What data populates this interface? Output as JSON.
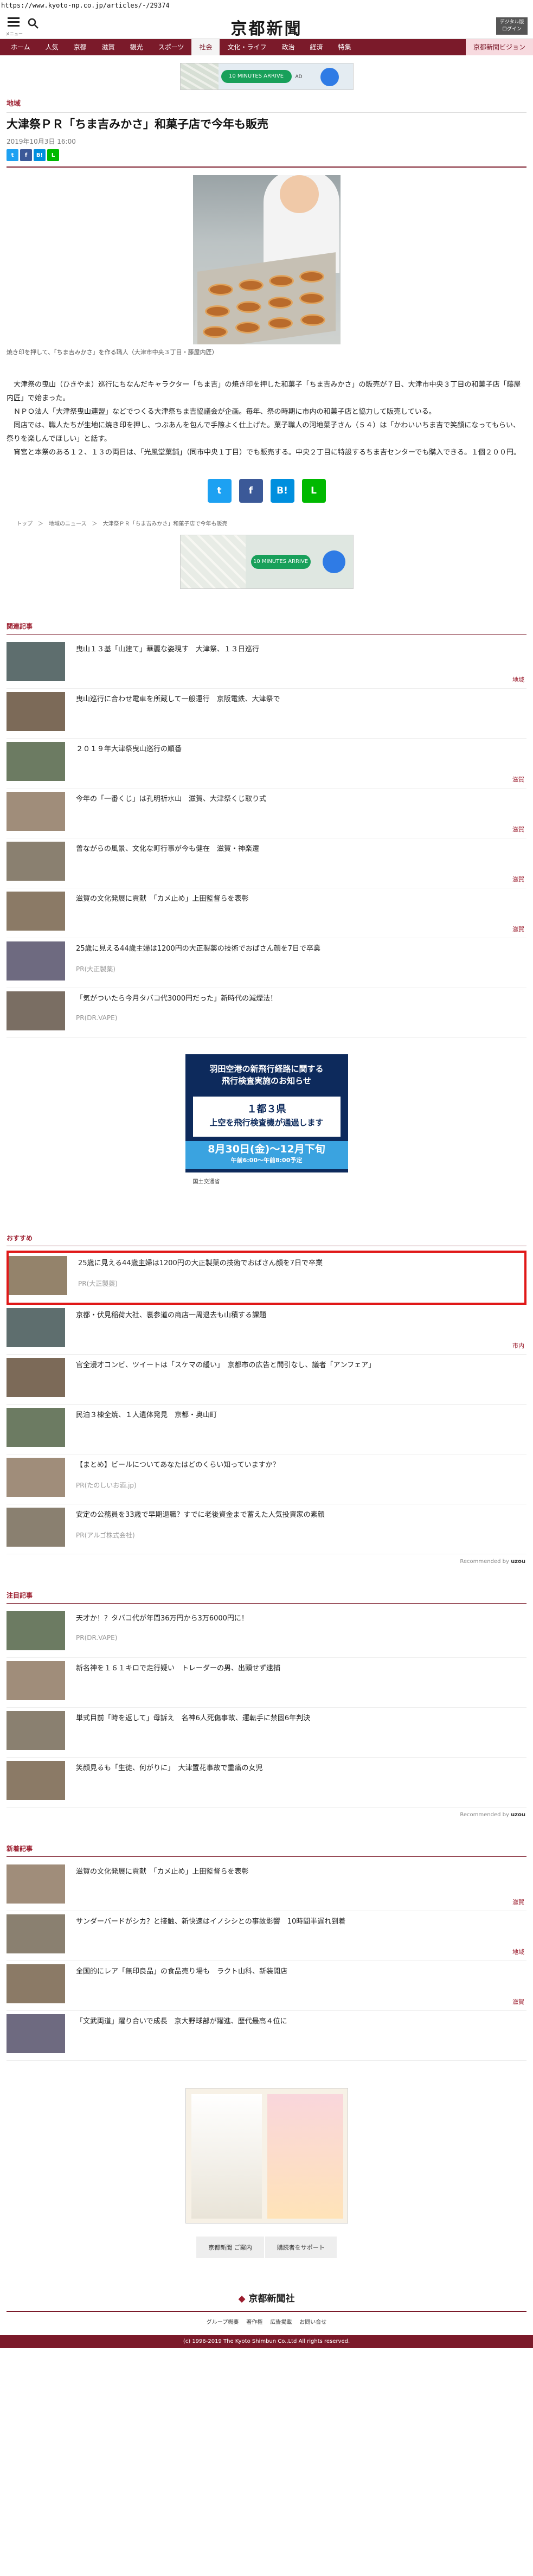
{
  "url": "https://www.kyoto-np.co.jp/articles/-/29374",
  "header": {
    "menu_label": "メニュー",
    "search_label": "検索",
    "logo": "京都新聞",
    "digital_label": "デジタル版",
    "digital_label2": "ログイン"
  },
  "nav": [
    "ホーム",
    "人気",
    "京都",
    "滋賀",
    "観光",
    "スポーツ",
    "社会",
    "文化・ライフ",
    "政治",
    "経済",
    "特集",
    "京都新聞ビジョン"
  ],
  "ad_top": {
    "pill": "10 MINUTES ARRIVE",
    "small": "AD"
  },
  "article": {
    "section": "地域",
    "title": "大津祭ＰＲ「ちま吉みかさ」和菓子店で今年も販売",
    "date": "2019年10月3日 16:00",
    "caption": "焼き印を押して、「ちま吉みかさ」を作る職人（大津市中央３丁目・藤屋内匠）",
    "paragraphs": [
      "大津祭の曳山（ひきやま）巡行にちなんだキャラクター「ちま吉」の焼き印を押した和菓子「ちま吉みかさ」の販売が７日、大津市中央３丁目の和菓子店「藤屋内匠」で始まった。",
      "ＮＰＯ法人「大津祭曳山連盟」などでつくる大津祭ちま吉協議会が企画。毎年、祭の時期に市内の和菓子店と協力して販売している。",
      "同店では、職人たちが生地に焼き印を押し、つぶあんを包んで手際よく仕上げた。菓子職人の河地菜子さん（５４）は「かわいいちま吉で笑顔になってもらい、祭りを楽しんでほしい」と話す。",
      "宵宮と本祭のある１２、１３の両日は、「光風堂菓舗」（同市中央１丁目）でも販売する。中央２丁目に特設するちま吉センターでも購入できる。１個２００円。"
    ],
    "breadcrumb": "トップ　＞　地域のニュース　＞　大津祭ＰＲ「ちま吉みかさ」和菓子店で今年も販売"
  },
  "related": {
    "heading": "関連記事",
    "items": [
      {
        "title": "曳山１３基「山建て」華麗な姿現す　大津祭、１３日巡行",
        "cat": "地域"
      },
      {
        "title": "曳山巡行に合わせ電車を所蔵して一般運行　京阪電鉄、大津祭で",
        "cat": ""
      },
      {
        "title": "２０１９年大津祭曳山巡行の順番",
        "cat": "滋賀"
      },
      {
        "title": "今年の「一番くじ」は孔明祈水山　滋賀、大津祭くじ取り式",
        "cat": "滋賀"
      },
      {
        "title": "曾ながらの風景、文化な町行事が今も健在　滋賀・神楽遷",
        "cat": "滋賀"
      },
      {
        "title": "滋賀の文化発展に貢献　「カメ止め」上田監督らを表彰",
        "cat": "滋賀"
      },
      {
        "title": "25歳に見える44歳主婦は1200円の大正製薬の技術でおばさん顔を7日で卒業",
        "cat": "",
        "sponsor": "PR(大正製薬)"
      },
      {
        "title": "「気がついたら今月タバコ代3000円だった」新時代の減煙法！",
        "cat": "",
        "sponsor": "PR(DR.VAPE)"
      }
    ]
  },
  "ad_mid": {
    "line1": "羽田空港の新飛行経路に関する",
    "line2": "飛行検査実施のお知らせ",
    "mid1": "１都３県",
    "mid2": "上空を飛行検査機が通過します",
    "band1": "8月30日(金)〜12月下旬",
    "band2": "午前6:00〜午前8:00予定",
    "foot": "国土交通省"
  },
  "recommended": {
    "heading": "おすすめ",
    "items": [
      {
        "title": "25歳に見える44歳主婦は1200円の大正製薬の技術でおばさん顔を7日で卒業",
        "sponsor": "PR(大正製薬)"
      },
      {
        "title": "京都・伏見稲荷大社、裏参道の商店一周退去も山積する課題",
        "cat": "市内"
      },
      {
        "title": "官全漫才コンビ、ツイートは「スケマの緩い」　京都市の広告と間引なし、議者「アンフェア」",
        "cat": ""
      },
      {
        "title": "民泊３棟全焼、１人遺体発見　京都・奥山町",
        "cat": ""
      },
      {
        "title": "【まとめ】ビールについてあなたはどのくらい知っていますか？",
        "sponsor": "PR(たのしいお酒.jp)"
      },
      {
        "title": "安定の公務員を33歳で早期退職？すでに老後資金まで蓄えた人気投資家の素顔",
        "sponsor": "PR(アルゴ株式会社)"
      }
    ],
    "by": "Recommended by"
  },
  "popular": {
    "heading": "注目記事",
    "items": [
      {
        "title": "天才か！？タバコ代が年間36万円から3万6000円に！",
        "sponsor": "PR(DR.VAPE)"
      },
      {
        "title": "新名神を１６１キロで走行疑い　トレーダーの男、出頭せず逮捕",
        "cat": ""
      },
      {
        "title": "単式目前「時を返して」母訴え　名神6人死傷事故、運転手に禁固6年判決",
        "cat": ""
      },
      {
        "title": "笑顔見るも「生徒、何がりに」　大津置花事故で重痛の女児",
        "cat": ""
      }
    ],
    "by": "Recommended by"
  },
  "latest": {
    "heading": "新着記事",
    "items": [
      {
        "title": "滋賀の文化発展に貢献　「カメ止め」上田監督らを表彰",
        "cat": "滋賀"
      },
      {
        "title": "サンダーバードがシカ？と接触、新快速はイノシシとの事故影響　10時間半遅れ到着",
        "cat": "地域"
      },
      {
        "title": "全国的にレア「無印良品」の食品売り場も　ラクト山科、新装開店",
        "cat": "滋賀"
      },
      {
        "title": "「文武両道」躍り合いで成長　京大野球部が躍進、歴代最高４位に",
        "cat": ""
      }
    ]
  },
  "footer": {
    "btn1": "京都新聞 ご案内",
    "btn2": "購読者をサポート",
    "logo": "京都新聞社",
    "links": [
      "グループ概要",
      "著作権",
      "広告掲載",
      "お問い合せ"
    ],
    "copyright": "(c) 1996-2019 The Kyoto Shimbun Co.,Ltd All rights reserved."
  }
}
